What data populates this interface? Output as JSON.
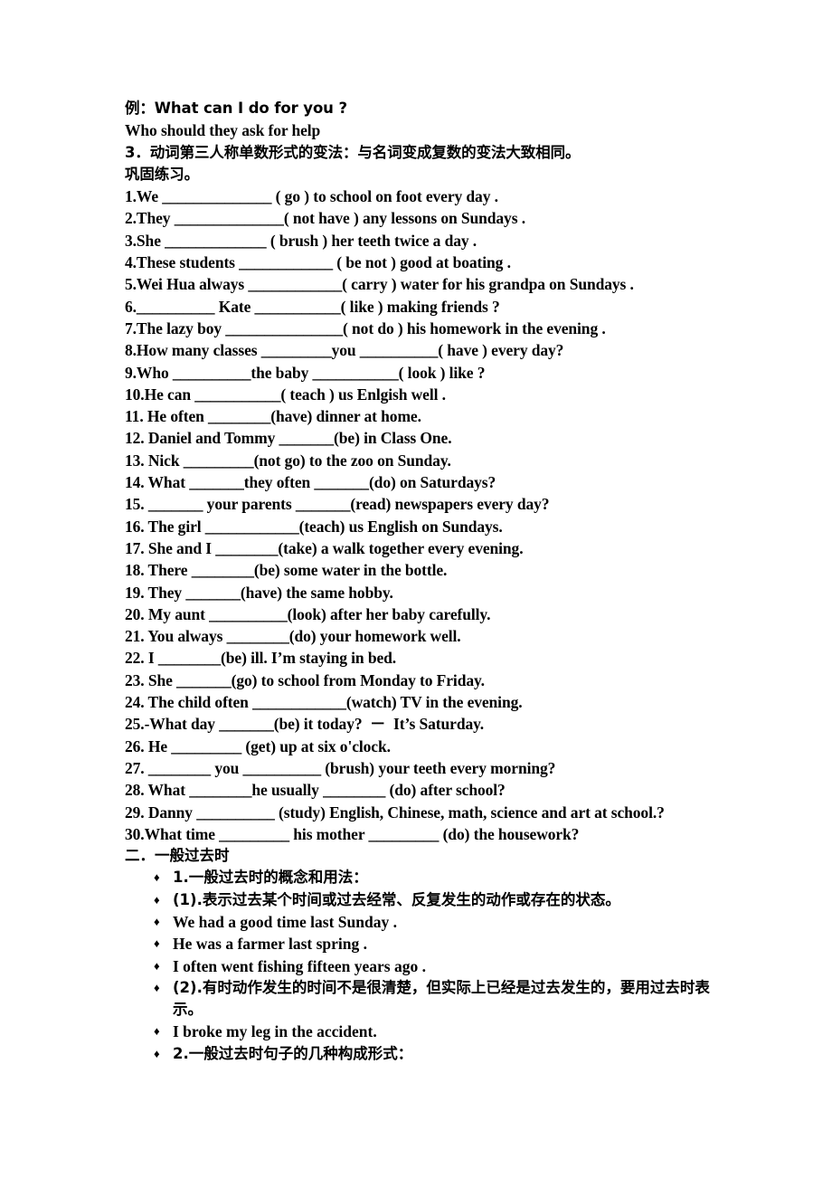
{
  "document": {
    "intro_lines": [
      "例：What can I do for you ?",
      "Who should they ask for help"
    ],
    "rule_line": "3．动词第三人称单数形式的变法：与名词变成复数的变法大致相同。",
    "practice_heading": "巩固练习。",
    "exercises": [
      "1.We ______________ ( go ) to school on foot every day .",
      "2.They ______________( not have ) any lessons on Sundays .",
      "3.She _____________ ( brush ) her teeth twice a day .",
      "4.These students ____________ ( be not ) good at boating .",
      "5.Wei Hua always ____________( carry ) water for his grandpa on Sundays .",
      "6.__________ Kate ___________( like ) making friends ?",
      "7.The lazy boy _______________( not do ) his homework in the evening .",
      "8.How many classes _________you __________( have ) every day?",
      "9.Who __________the baby ___________( look ) like ?",
      "10.He can ___________( teach ) us Enlgish well .",
      "11. He often ________(have) dinner at home.",
      "12. Daniel and Tommy _______(be) in Class One.",
      "13. Nick _________(not go) to the zoo on Sunday.",
      "14. What _______they often _______(do) on Saturdays?",
      "15. _______ your parents _______(read) newspapers every day?",
      "16. The girl ____________(teach) us English on Sundays.",
      "17. She and I ________(take) a walk together every evening.",
      "18. There ________(be) some water in the bottle.",
      "19. They _______(have) the same hobby.",
      "20. My aunt __________(look) after her baby carefully.",
      "21. You always ________(do) your homework well.",
      "22. I ________(be) ill. I’m staying in bed.",
      "23. She _______(go) to school from Monday to Friday.",
      "24. The child often ____________(watch) TV in the evening.",
      "25.-What day _______(be) it today?  －  It’s Saturday.",
      "26. He _________ (get) up at six o'clock.",
      "27. ________ you __________ (brush) your teeth every morning?",
      "28. What ________he usually ________ (do) after school?",
      "29. Danny __________ (study) English, Chinese, math, science and art at school.?",
      "30.What time _________ his mother _________ (do) the housework?"
    ],
    "section_two_heading": "二．一般过去时",
    "bullets": [
      {
        "mark": "♦",
        "text": "1.一般过去时的概念和用法：",
        "lang": "cn",
        "wrap": false
      },
      {
        "mark": "♦",
        "text": "(1).表示过去某个时间或过去经常、反复发生的动作或存在的状态。",
        "lang": "cn",
        "wrap": false
      },
      {
        "mark": "♦",
        "text": "We had a good time last Sunday .",
        "lang": "en",
        "wrap": false
      },
      {
        "mark": "♦",
        "text": "He was a farmer last spring .",
        "lang": "en",
        "wrap": false
      },
      {
        "mark": "♦",
        "text": "I often went fishing fifteen years ago .",
        "lang": "en",
        "wrap": false
      },
      {
        "mark": "♦",
        "text": "(2).有时动作发生的时间不是很清楚，但实际上已经是过去发生的，要用过去时表示。",
        "lang": "cn",
        "wrap": true
      },
      {
        "mark": "♦",
        "text": "I broke my leg in the accident.",
        "lang": "en",
        "wrap": false
      },
      {
        "mark": "♦",
        "text": "2.一般过去时句子的几种构成形式：",
        "lang": "cn",
        "wrap": false
      }
    ]
  }
}
